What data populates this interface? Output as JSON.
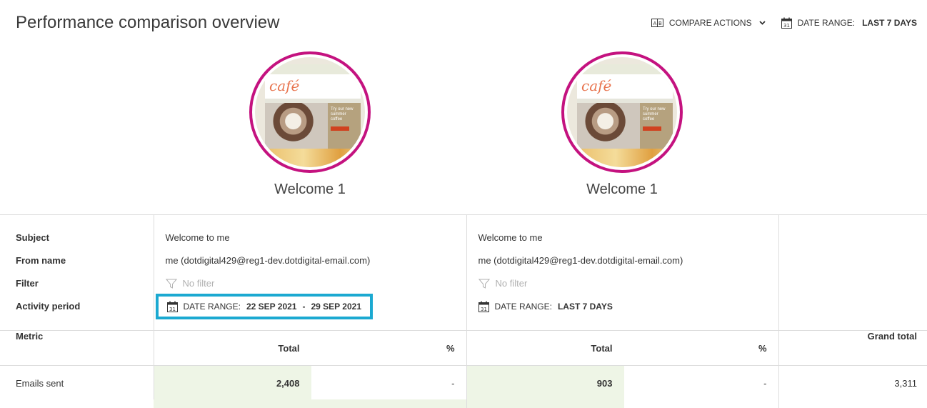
{
  "page": {
    "title": "Performance comparison overview"
  },
  "toolbar": {
    "compare_actions_label": "COMPARE ACTIONS",
    "date_range_label": "DATE RANGE:",
    "date_range_value": "LAST 7 DAYS"
  },
  "campaigns": [
    {
      "name": "Welcome 1",
      "thumbnail_logo": "café",
      "thumbnail_promo": "Try our new summer coffee"
    },
    {
      "name": "Welcome 1",
      "thumbnail_logo": "café",
      "thumbnail_promo": "Try our new summer coffee"
    }
  ],
  "meta_labels": {
    "subject": "Subject",
    "from_name": "From name",
    "filter": "Filter",
    "activity_period": "Activity period"
  },
  "details": [
    {
      "subject": "Welcome to me",
      "from_name": "me (dotdigital429@reg1-dev.dotdigital-email.com)",
      "filter": "No filter",
      "date_range_label": "DATE RANGE:",
      "date_range_start": "22 SEP 2021",
      "date_range_sep": "-",
      "date_range_end": "29 SEP 2021"
    },
    {
      "subject": "Welcome to me",
      "from_name": "me (dotdigital429@reg1-dev.dotdigital-email.com)",
      "filter": "No filter",
      "date_range_label": "DATE RANGE:",
      "date_range_value": "LAST 7 DAYS"
    }
  ],
  "table": {
    "headers": {
      "metric": "Metric",
      "total": "Total",
      "percent": "%",
      "grand_total": "Grand total"
    },
    "rows": [
      {
        "metric": "Emails sent",
        "c1_total": "2,408",
        "c1_pct": "-",
        "c2_total": "903",
        "c2_pct": "-",
        "grand_total": "3,311"
      }
    ]
  },
  "colors": {
    "ring": "#c4127f",
    "highlight_border": "#1ba9d1",
    "total_fill": "#eef5e6"
  },
  "icons": [
    "compare-icon",
    "chevron-down-icon",
    "calendar-icon",
    "funnel-icon"
  ]
}
